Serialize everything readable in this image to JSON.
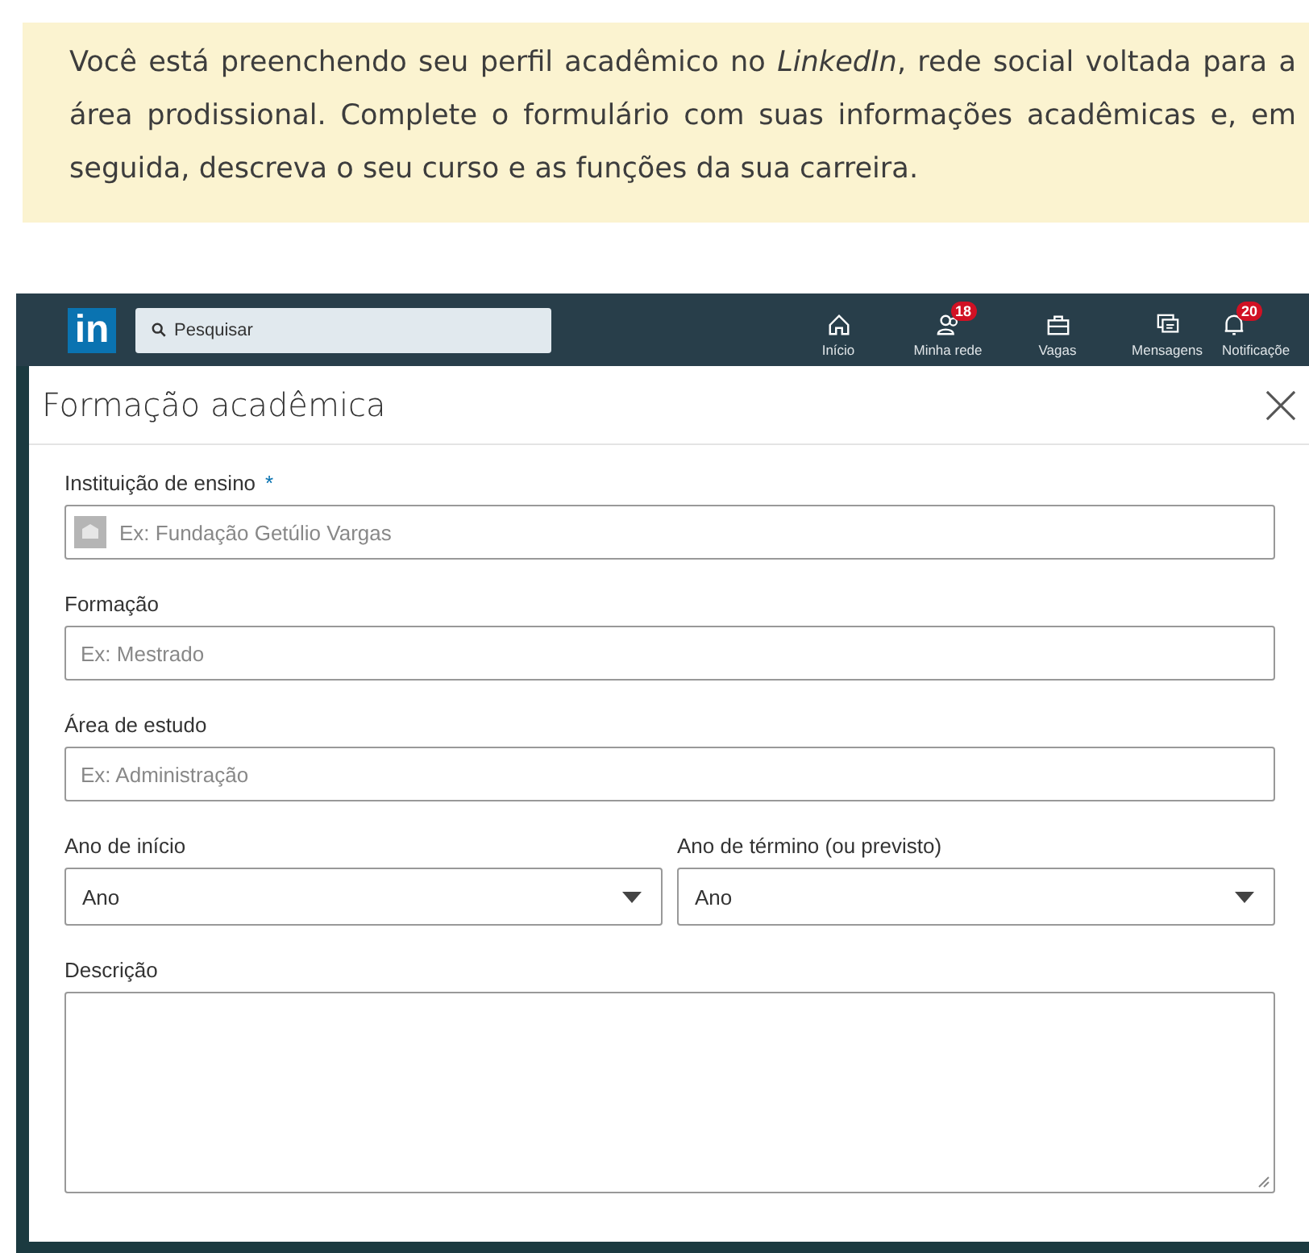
{
  "instruction": "Você está preenchendo seu perfil acadêmico no *LinkedIn*, rede social voltada para a área prodissional. Complete o formulário com suas informações acadêmicas e, em seguida, descreva o seu curso e as funções da sua carreira.",
  "navbar": {
    "logo": "in",
    "search": {
      "placeholder": "Pesquisar"
    },
    "items": [
      {
        "kind": "home",
        "label": "Início"
      },
      {
        "kind": "network",
        "label": "Minha rede",
        "badge": "18"
      },
      {
        "kind": "jobs",
        "label": "Vagas"
      },
      {
        "kind": "messages",
        "label": "Mensagens"
      },
      {
        "kind": "notifications",
        "label": "Notificaçõe",
        "badge": "20"
      }
    ]
  },
  "modal": {
    "title": "Formação acadêmica",
    "rows": [
      {
        "fields": [
          {
            "kind": "text",
            "label": "Instituição de ensino",
            "required_mark": "*",
            "has_icon": true,
            "placeholder": "Ex: Fundação Getúlio Vargas"
          }
        ]
      },
      {
        "fields": [
          {
            "kind": "text",
            "label": "Formação",
            "placeholder": "Ex: Mestrado"
          }
        ]
      },
      {
        "fields": [
          {
            "kind": "text",
            "label": "Área de estudo",
            "placeholder": "Ex: Administração"
          }
        ]
      },
      {
        "fields": [
          {
            "kind": "select",
            "label": "Ano de início",
            "value": "Ano"
          },
          {
            "kind": "select",
            "label": "Ano de término (ou previsto)",
            "value": "Ano"
          }
        ]
      },
      {
        "fields": [
          {
            "kind": "textarea",
            "label": "Descrição"
          }
        ]
      }
    ]
  }
}
